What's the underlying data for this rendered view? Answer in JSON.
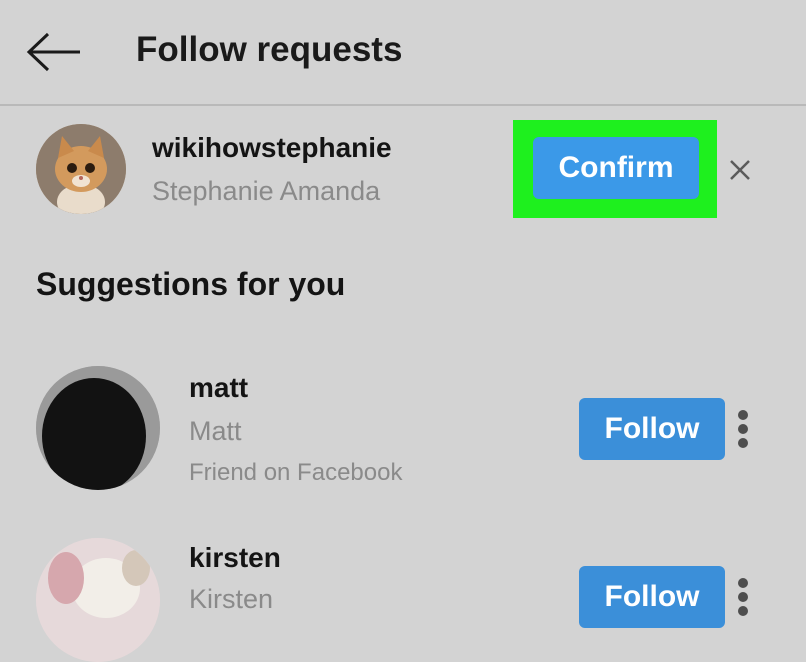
{
  "header": {
    "back_icon": "arrow-left-icon",
    "title": "Follow requests"
  },
  "request": {
    "username": "wikihowstephanie",
    "full_name": "Stephanie Amanda",
    "confirm_label": "Confirm",
    "dismiss_icon": "close-icon",
    "highlight_color": "#1ef01e",
    "button_color": "#3b99e8"
  },
  "suggestions": {
    "heading": "Suggestions for you",
    "items": [
      {
        "username": "matt",
        "full_name": "Matt",
        "subtitle": "Friend on Facebook",
        "follow_label": "Follow",
        "more_icon": "more-vertical-icon"
      },
      {
        "username": "kirsten",
        "full_name": "Kirsten",
        "follow_label": "Follow",
        "more_icon": "more-vertical-icon"
      }
    ]
  }
}
